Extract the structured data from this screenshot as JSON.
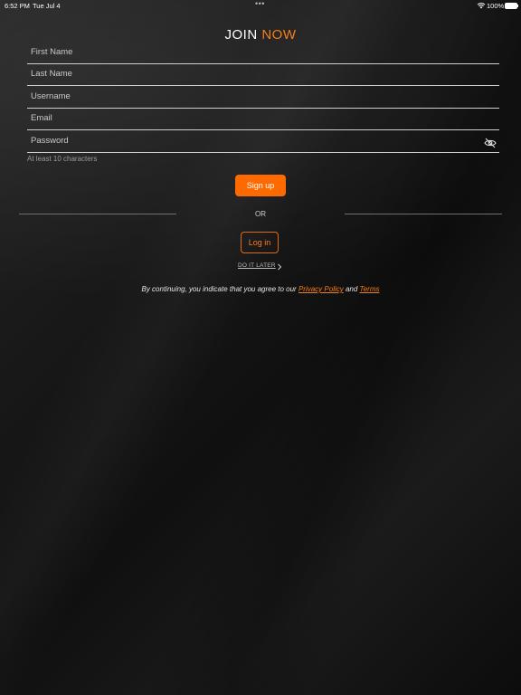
{
  "status_bar": {
    "time": "6:52 PM",
    "date": "Tue Jul 4",
    "battery": "100%"
  },
  "title": {
    "word1": "JOIN",
    "word2": "NOW"
  },
  "form": {
    "first_name_placeholder": "First Name",
    "last_name_placeholder": "Last Name",
    "username_placeholder": "Username",
    "email_placeholder": "Email",
    "password_placeholder": "Password",
    "password_hint": "At least 10 characters"
  },
  "actions": {
    "signup_label": "Sign up",
    "or_label": "OR",
    "login_label": "Log in",
    "later_label": "DO IT LATER"
  },
  "legal": {
    "prefix": "By continuing, you indicate that you agree to our ",
    "privacy_label": "Privacy Policy",
    "and": " and ",
    "terms_label": "Terms"
  },
  "colors": {
    "accent": "#ff6a00",
    "accent_text": "#f57f17",
    "background": "#151515"
  },
  "icons": {
    "password_toggle": "eye-slash-icon",
    "later_chevron": "chevron-right-icon",
    "wifi": "wifi-icon",
    "battery": "battery-icon"
  }
}
